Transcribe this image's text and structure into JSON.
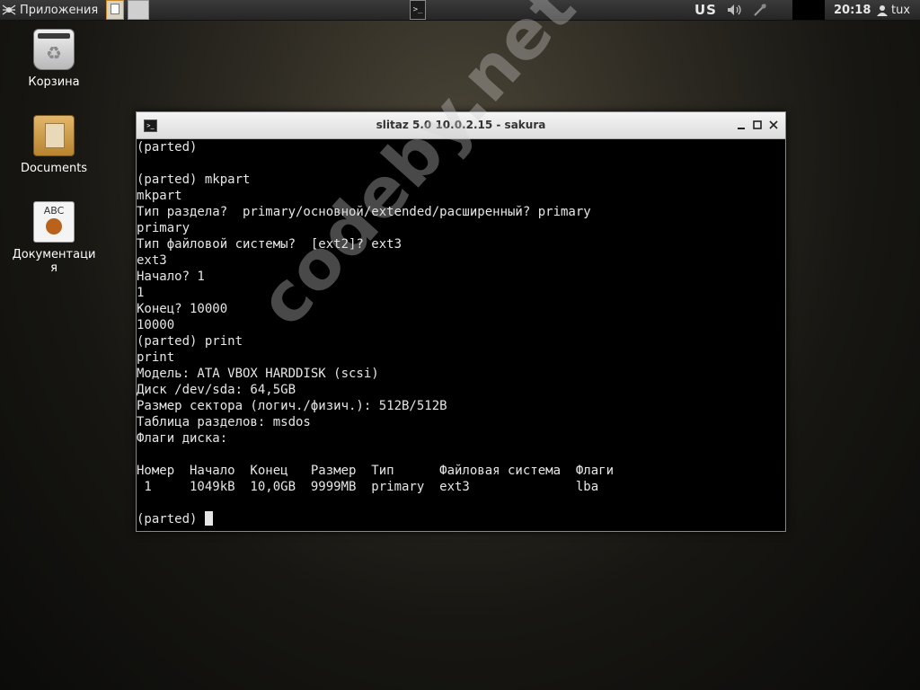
{
  "panel": {
    "apps_label": "Приложения",
    "keyboard_layout": "US",
    "clock": "20:18",
    "user": "tux"
  },
  "desktop": {
    "icons": [
      {
        "label": "Корзина"
      },
      {
        "label": "Documents"
      },
      {
        "label": "Документация",
        "icon_text": "ABC"
      }
    ]
  },
  "terminal": {
    "title": "slitaz 5.0 10.0.2.15  - sakura",
    "lines": [
      "(parted)",
      "",
      "(parted) mkpart",
      "mkpart",
      "Тип раздела?  primary/основной/extended/расширенный? primary",
      "primary",
      "Тип файловой системы?  [ext2]? ext3",
      "ext3",
      "Начало? 1",
      "1",
      "Конец? 10000",
      "10000",
      "(parted) print",
      "print",
      "Модель: ATA VBOX HARDDISK (scsi)",
      "Диск /dev/sda: 64,5GB",
      "Размер сектора (логич./физич.): 512B/512B",
      "Таблица разделов: msdos",
      "Флаги диска:",
      "",
      "Номер  Начало  Конец   Размер  Тип      Файловая система  Флаги",
      " 1     1049kB  10,0GB  9999MB  primary  ext3              lba",
      "",
      "(parted) "
    ]
  },
  "watermark": "codeby.net"
}
